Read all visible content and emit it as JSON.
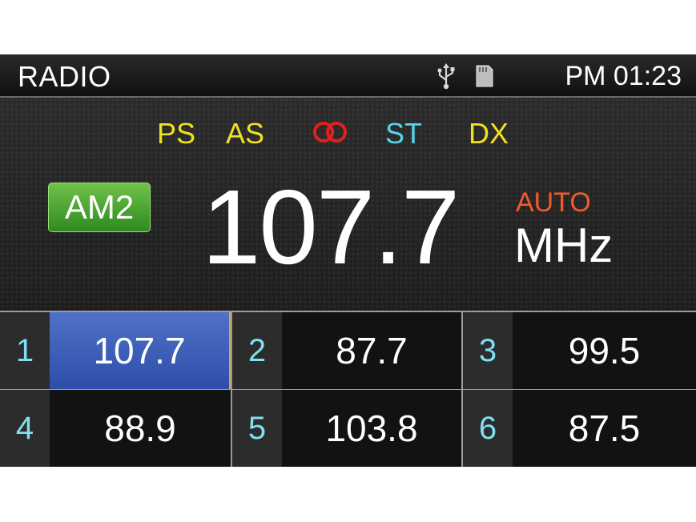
{
  "header": {
    "title": "RADIO",
    "usb_icon": "usb-icon",
    "sd_icon": "sd-card-icon",
    "clock": "PM 01:23"
  },
  "indicators": {
    "ps": "PS",
    "as": "AS",
    "stereo_icon": "stereo-icon",
    "stereo_color": "#e02020",
    "st": "ST",
    "dx": "DX"
  },
  "tuner": {
    "band": "AM2",
    "frequency": "107.7",
    "mode": "AUTO",
    "unit": "MHz"
  },
  "colors": {
    "indicator_yellow": "#f0e020",
    "indicator_cyan": "#55d4ea",
    "mode_orange": "#f25a2a",
    "band_green": "#3f9e2a",
    "active_preset_blue": "#3d5fb8"
  },
  "presets": [
    {
      "number": "1",
      "frequency": "107.7",
      "active": true
    },
    {
      "number": "2",
      "frequency": "87.7",
      "active": false
    },
    {
      "number": "3",
      "frequency": "99.5",
      "active": false
    },
    {
      "number": "4",
      "frequency": "88.9",
      "active": false
    },
    {
      "number": "5",
      "frequency": "103.8",
      "active": false
    },
    {
      "number": "6",
      "frequency": "87.5",
      "active": false
    }
  ]
}
